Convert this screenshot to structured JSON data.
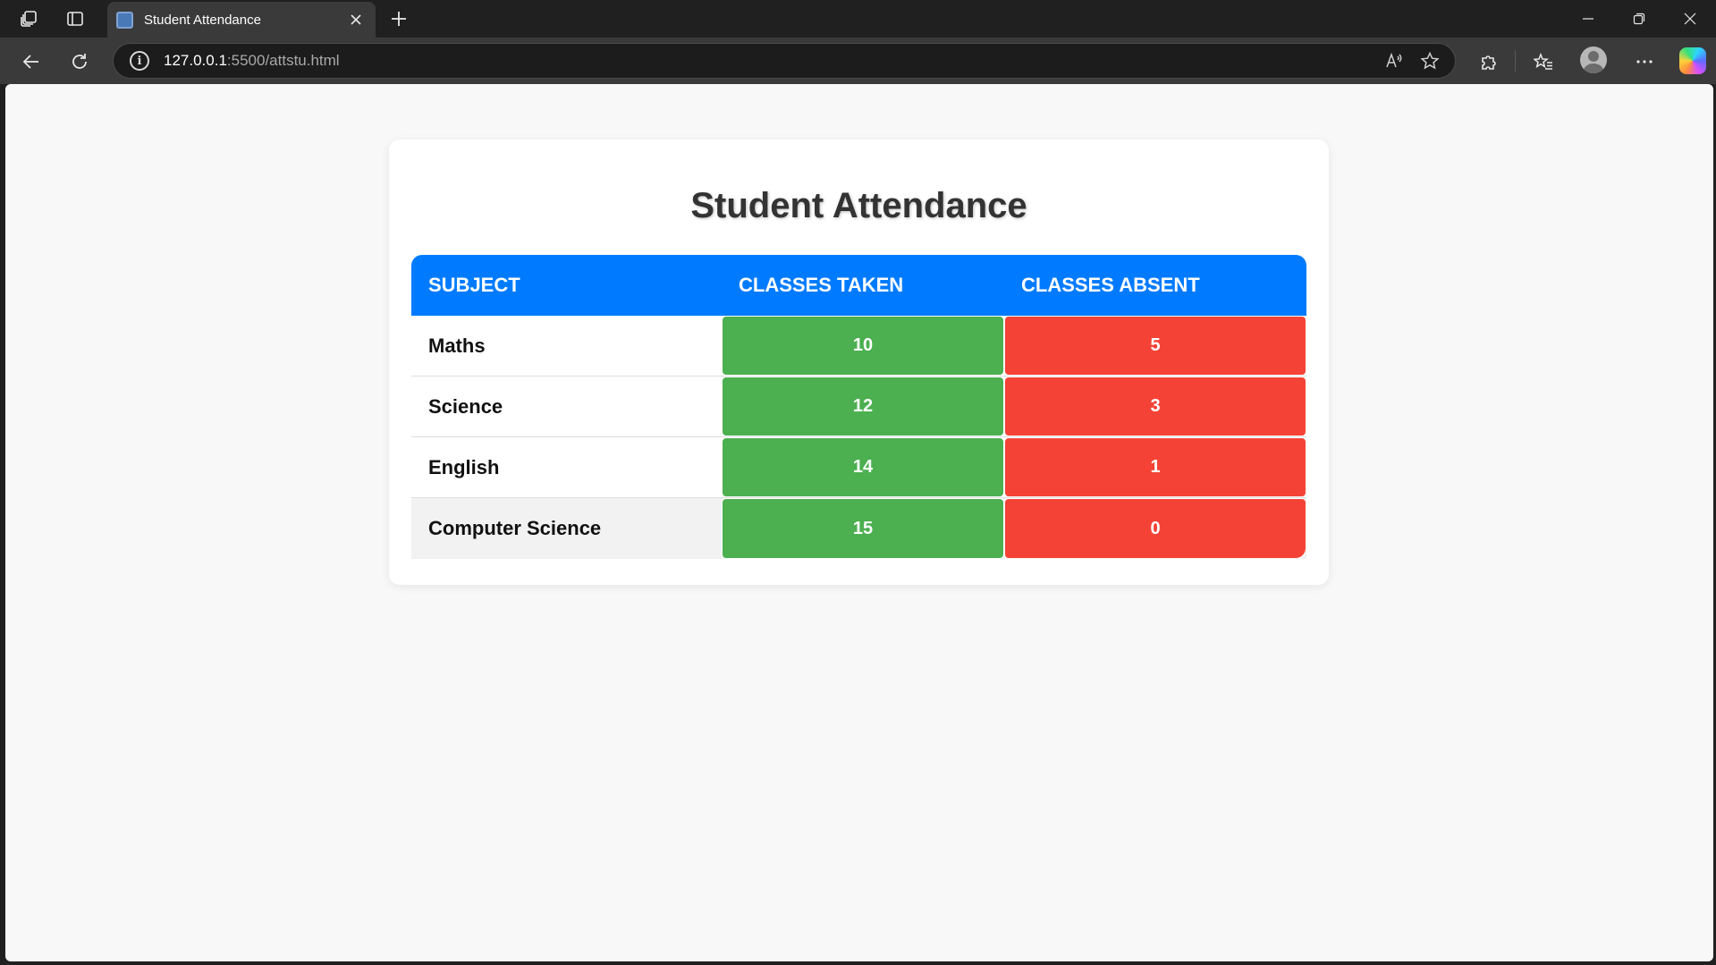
{
  "browser": {
    "tab": {
      "title": "Student Attendance"
    },
    "url": {
      "host": "127.0.0.1",
      "rest": ":5500/attstu.html"
    },
    "icons": {
      "workspaces": "workspaces-icon",
      "tab_actions": "tab-actions-icon",
      "close_tab": "close-icon",
      "new_tab": "plus-icon",
      "minimize": "minimize-icon",
      "restore": "restore-icon",
      "close_window": "close-icon",
      "back": "back-arrow-icon",
      "refresh": "refresh-icon",
      "site_info": "info-icon",
      "read_aloud": "read-aloud-icon",
      "favorite": "star-icon",
      "extensions": "puzzle-icon",
      "favorites": "favorites-icon",
      "profile": "avatar-icon",
      "more": "ellipsis-icon",
      "copilot": "copilot-icon"
    }
  },
  "page": {
    "heading": "Student Attendance",
    "table": {
      "headers": [
        "SUBJECT",
        "CLASSES TAKEN",
        "CLASSES ABSENT"
      ],
      "rows": [
        {
          "subject": "Maths",
          "taken": "10",
          "absent": "5"
        },
        {
          "subject": "Science",
          "taken": "12",
          "absent": "3"
        },
        {
          "subject": "English",
          "taken": "14",
          "absent": "1"
        },
        {
          "subject": "Computer Science",
          "taken": "15",
          "absent": "0"
        }
      ]
    },
    "colors": {
      "header": "#007bff",
      "taken": "#4caf50",
      "absent": "#f44336",
      "background": "#f8f8f8"
    }
  }
}
